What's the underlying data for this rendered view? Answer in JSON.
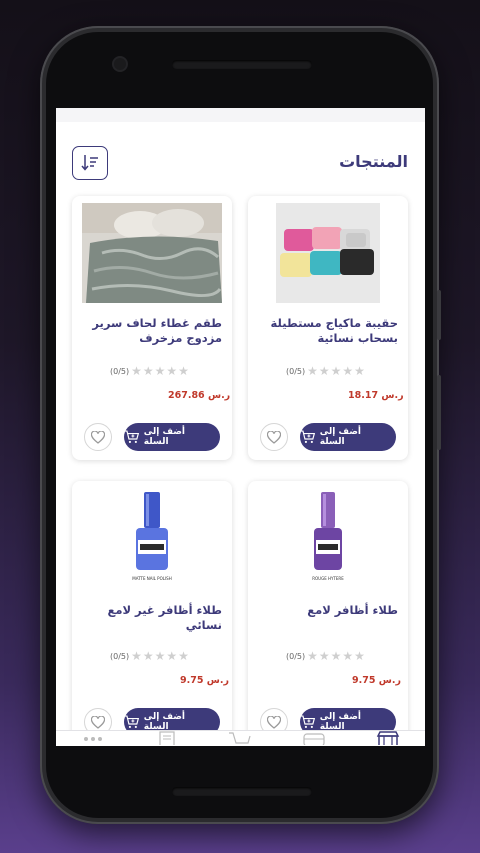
{
  "header": {
    "title": "المنتجات"
  },
  "products": [
    {
      "name": "حقيبة ماكياج مستطيلة بسحاب نسائية",
      "rating_text": "(0/5)",
      "price": "18.17 ر.س",
      "add_to_cart_label": "أضف إلى السلة"
    },
    {
      "name": "طقم غطاء لحاف سرير مزدوج مزخرف",
      "rating_text": "(0/5)",
      "price": "267.86 ر.س",
      "add_to_cart_label": "أضف إلى السلة"
    },
    {
      "name": "طلاء أظافر لامع",
      "rating_text": "(0/5)",
      "price": "9.75 ر.س",
      "add_to_cart_label": "أضف إلى السلة",
      "image_label": "ROUGE HYTERE"
    },
    {
      "name": "طلاء أظافر غير لامع نسائي",
      "rating_text": "(0/5)",
      "price": "9.75 ر.س",
      "add_to_cart_label": "أضف إلى السلة",
      "image_label": "MATTE NAIL POLISH"
    }
  ],
  "colors": {
    "brand": "#3d3a7a",
    "price": "#c0392b"
  },
  "bottom_nav": [
    "home-icon",
    "categories-icon",
    "cart-icon",
    "orders-icon",
    "more-icon"
  ]
}
